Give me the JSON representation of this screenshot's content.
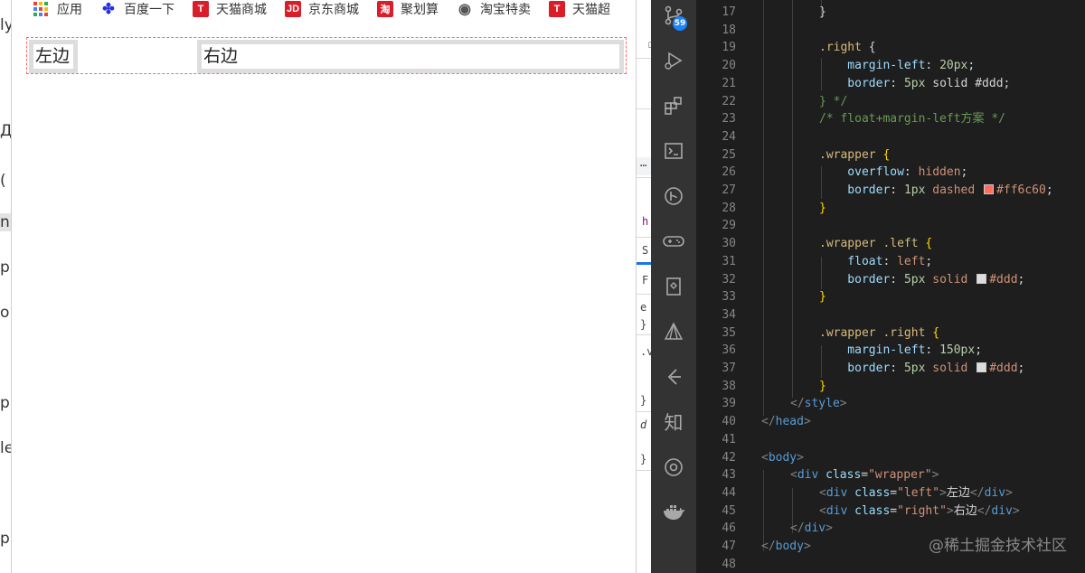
{
  "left_sliver": {
    "chars": [
      "ly",
      "Д",
      "(",
      "n",
      "p",
      "o",
      "p",
      "le",
      "p"
    ]
  },
  "bookmarks": [
    {
      "label": "应用",
      "icon": "apps-grid-icon"
    },
    {
      "label": "百度一下",
      "icon": "baidu-paw-icon"
    },
    {
      "label": "天猫商城",
      "icon": "tmall-icon",
      "glyph": "T"
    },
    {
      "label": "京东商城",
      "icon": "jd-icon",
      "glyph": "JD"
    },
    {
      "label": "聚划算",
      "icon": "juhuasuan-icon",
      "glyph": "淘"
    },
    {
      "label": "淘宝特卖",
      "icon": "globe-icon"
    },
    {
      "label": "天猫超",
      "icon": "tmall-icon",
      "glyph": "T"
    }
  ],
  "demo": {
    "left_text": "左边",
    "right_text": "右边"
  },
  "devtools": {
    "frags": [
      "h",
      "S",
      "F",
      "e",
      "}",
      ".v",
      "}",
      "d",
      "}"
    ]
  },
  "activity_bar": {
    "scm_badge": "59"
  },
  "editor": {
    "lines": [
      {
        "n": "17",
        "tokens": [
          {
            "t": "}",
            "c": "t-text"
          }
        ]
      },
      {
        "n": "18",
        "tokens": []
      },
      {
        "n": "19",
        "tokens": [
          {
            "t": ".right",
            "c": "t-sel"
          },
          {
            "t": " {",
            "c": "t-text"
          }
        ]
      },
      {
        "n": "20",
        "tokens": [
          {
            "t": "    margin-left",
            "c": "t-prop"
          },
          {
            "t": ": ",
            "c": "t-text"
          },
          {
            "t": "20px",
            "c": "t-num"
          },
          {
            "t": ";",
            "c": "t-text"
          }
        ]
      },
      {
        "n": "21",
        "tokens": [
          {
            "t": "    border",
            "c": "t-prop"
          },
          {
            "t": ": ",
            "c": "t-text"
          },
          {
            "t": "5px",
            "c": "t-num"
          },
          {
            "t": " solid #ddd;",
            "c": "t-text"
          }
        ]
      },
      {
        "n": "22",
        "tokens": [
          {
            "t": "} */",
            "c": "t-com"
          }
        ]
      },
      {
        "n": "23",
        "tokens": [
          {
            "t": "/* float+margin-left方案 */",
            "c": "t-com"
          }
        ]
      },
      {
        "n": "24",
        "tokens": []
      },
      {
        "n": "25",
        "tokens": [
          {
            "t": ".wrapper",
            "c": "t-sel"
          },
          {
            "t": " {",
            "c": "t-brace"
          }
        ]
      },
      {
        "n": "26",
        "tokens": [
          {
            "t": "    overflow",
            "c": "t-prop"
          },
          {
            "t": ": ",
            "c": "t-text"
          },
          {
            "t": "hidden",
            "c": "t-val"
          },
          {
            "t": ";",
            "c": "t-text"
          }
        ]
      },
      {
        "n": "27",
        "tokens": [
          {
            "t": "    border",
            "c": "t-prop"
          },
          {
            "t": ": ",
            "c": "t-text"
          },
          {
            "t": "1px",
            "c": "t-num"
          },
          {
            "t": " dashed ",
            "c": "t-val"
          },
          {
            "t": "",
            "c": "swatch",
            "color": "#ff6c60"
          },
          {
            "t": "#ff6c60",
            "c": "t-val"
          },
          {
            "t": ";",
            "c": "t-text"
          }
        ]
      },
      {
        "n": "28",
        "tokens": [
          {
            "t": "}",
            "c": "t-brace"
          }
        ]
      },
      {
        "n": "29",
        "tokens": []
      },
      {
        "n": "30",
        "tokens": [
          {
            "t": ".wrapper .left",
            "c": "t-sel"
          },
          {
            "t": " {",
            "c": "t-brace"
          }
        ]
      },
      {
        "n": "31",
        "tokens": [
          {
            "t": "    float",
            "c": "t-prop"
          },
          {
            "t": ": ",
            "c": "t-text"
          },
          {
            "t": "left",
            "c": "t-val"
          },
          {
            "t": ";",
            "c": "t-text"
          }
        ]
      },
      {
        "n": "32",
        "tokens": [
          {
            "t": "    border",
            "c": "t-prop"
          },
          {
            "t": ": ",
            "c": "t-text"
          },
          {
            "t": "5px",
            "c": "t-num"
          },
          {
            "t": " solid ",
            "c": "t-val"
          },
          {
            "t": "",
            "c": "swatch",
            "color": "#dddddd"
          },
          {
            "t": "#ddd",
            "c": "t-val"
          },
          {
            "t": ";",
            "c": "t-text"
          }
        ]
      },
      {
        "n": "33",
        "tokens": [
          {
            "t": "}",
            "c": "t-brace"
          }
        ]
      },
      {
        "n": "34",
        "tokens": []
      },
      {
        "n": "35",
        "tokens": [
          {
            "t": ".wrapper .right",
            "c": "t-sel"
          },
          {
            "t": " {",
            "c": "t-brace"
          }
        ]
      },
      {
        "n": "36",
        "tokens": [
          {
            "t": "    margin-left",
            "c": "t-prop"
          },
          {
            "t": ": ",
            "c": "t-text"
          },
          {
            "t": "150px",
            "c": "t-num"
          },
          {
            "t": ";",
            "c": "t-text"
          }
        ]
      },
      {
        "n": "37",
        "tokens": [
          {
            "t": "    border",
            "c": "t-prop"
          },
          {
            "t": ": ",
            "c": "t-text"
          },
          {
            "t": "5px",
            "c": "t-num"
          },
          {
            "t": " solid ",
            "c": "t-val"
          },
          {
            "t": "",
            "c": "swatch",
            "color": "#dddddd"
          },
          {
            "t": "#ddd",
            "c": "t-val"
          },
          {
            "t": ";",
            "c": "t-text"
          }
        ]
      },
      {
        "n": "38",
        "tokens": [
          {
            "t": "}",
            "c": "t-brace"
          }
        ]
      },
      {
        "n": "39",
        "tokens": [
          {
            "t": "</",
            "c": "t-punc"
          },
          {
            "t": "style",
            "c": "t-tag"
          },
          {
            "t": ">",
            "c": "t-punc"
          }
        ]
      },
      {
        "n": "40",
        "tokens": [
          {
            "t": "</",
            "c": "t-punc"
          },
          {
            "t": "head",
            "c": "t-tag"
          },
          {
            "t": ">",
            "c": "t-punc"
          }
        ]
      },
      {
        "n": "41",
        "tokens": []
      },
      {
        "n": "42",
        "tokens": [
          {
            "t": "<",
            "c": "t-punc"
          },
          {
            "t": "body",
            "c": "t-tag"
          },
          {
            "t": ">",
            "c": "t-punc"
          }
        ]
      },
      {
        "n": "43",
        "tokens": [
          {
            "t": "<",
            "c": "t-punc"
          },
          {
            "t": "div",
            "c": "t-tag"
          },
          {
            "t": " class",
            "c": "t-attr"
          },
          {
            "t": "=",
            "c": "t-text"
          },
          {
            "t": "\"wrapper\"",
            "c": "t-str"
          },
          {
            "t": ">",
            "c": "t-punc"
          }
        ]
      },
      {
        "n": "44",
        "tokens": [
          {
            "t": "<",
            "c": "t-punc"
          },
          {
            "t": "div",
            "c": "t-tag"
          },
          {
            "t": " class",
            "c": "t-attr"
          },
          {
            "t": "=",
            "c": "t-text"
          },
          {
            "t": "\"left\"",
            "c": "t-str"
          },
          {
            "t": ">",
            "c": "t-punc"
          },
          {
            "t": "左边",
            "c": "t-text"
          },
          {
            "t": "</",
            "c": "t-punc"
          },
          {
            "t": "div",
            "c": "t-tag"
          },
          {
            "t": ">",
            "c": "t-punc"
          }
        ]
      },
      {
        "n": "45",
        "tokens": [
          {
            "t": "<",
            "c": "t-punc"
          },
          {
            "t": "div",
            "c": "t-tag"
          },
          {
            "t": " class",
            "c": "t-attr"
          },
          {
            "t": "=",
            "c": "t-text"
          },
          {
            "t": "\"right\"",
            "c": "t-str"
          },
          {
            "t": ">",
            "c": "t-punc"
          },
          {
            "t": "右边",
            "c": "t-text"
          },
          {
            "t": "</",
            "c": "t-punc"
          },
          {
            "t": "div",
            "c": "t-tag"
          },
          {
            "t": ">",
            "c": "t-punc"
          }
        ]
      },
      {
        "n": "46",
        "tokens": [
          {
            "t": "</",
            "c": "t-punc"
          },
          {
            "t": "div",
            "c": "t-tag"
          },
          {
            "t": ">",
            "c": "t-punc"
          }
        ]
      },
      {
        "n": "47",
        "tokens": [
          {
            "t": "</",
            "c": "t-punc"
          },
          {
            "t": "body",
            "c": "t-tag"
          },
          {
            "t": ">",
            "c": "t-punc"
          }
        ]
      },
      {
        "n": "48",
        "tokens": []
      }
    ]
  },
  "watermark": "@稀土掘金技术社区"
}
